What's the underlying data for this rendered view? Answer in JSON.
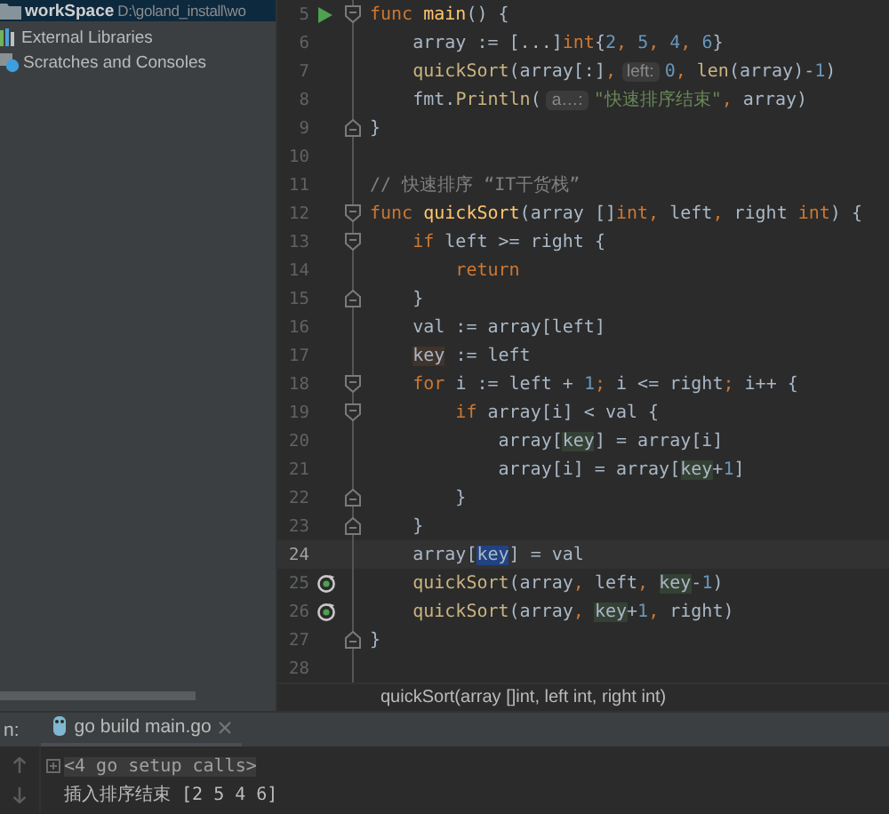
{
  "project_tree": {
    "items": [
      {
        "kind": "folder",
        "label": "workSpace",
        "path": "D:\\goland_install\\wo",
        "selected": true
      },
      {
        "kind": "library",
        "label": "External Libraries",
        "selected": false
      },
      {
        "kind": "scratches",
        "label": "Scratches and Consoles",
        "selected": false
      }
    ]
  },
  "editor": {
    "lines": [
      {
        "number": "5",
        "gutter": [
          {
            "kind": "run"
          },
          {
            "kind": "fold-start"
          }
        ],
        "current": false,
        "tokens": [
          {
            "kind": "keyword",
            "text": "func "
          },
          {
            "kind": "decl",
            "text": "main"
          },
          {
            "kind": "text",
            "text": "() {"
          }
        ]
      },
      {
        "number": "6",
        "current": false,
        "tokens": [
          {
            "kind": "text",
            "text": "    array := [...]"
          },
          {
            "kind": "keyword",
            "text": "int"
          },
          {
            "kind": "text",
            "text": "{"
          },
          {
            "kind": "number",
            "text": "2"
          },
          {
            "kind": "punct",
            "text": ", "
          },
          {
            "kind": "number",
            "text": "5"
          },
          {
            "kind": "punct",
            "text": ", "
          },
          {
            "kind": "number",
            "text": "4"
          },
          {
            "kind": "punct",
            "text": ", "
          },
          {
            "kind": "number",
            "text": "6"
          },
          {
            "kind": "text",
            "text": "}"
          }
        ]
      },
      {
        "number": "7",
        "current": false,
        "tokens": [
          {
            "kind": "call",
            "text": "    quickSort"
          },
          {
            "kind": "text",
            "text": "(array[:]"
          },
          {
            "kind": "punct",
            "text": ","
          },
          {
            "kind": "hint",
            "text": "left:"
          },
          {
            "kind": "number",
            "text": "0"
          },
          {
            "kind": "punct",
            "text": ", "
          },
          {
            "kind": "call",
            "text": "len"
          },
          {
            "kind": "text",
            "text": "(array)-"
          },
          {
            "kind": "number",
            "text": "1"
          },
          {
            "kind": "text",
            "text": ")"
          }
        ]
      },
      {
        "number": "8",
        "current": false,
        "tokens": [
          {
            "kind": "text",
            "text": "    fmt."
          },
          {
            "kind": "call",
            "text": "Println"
          },
          {
            "kind": "text",
            "text": "("
          },
          {
            "kind": "hint",
            "text": "a…:"
          },
          {
            "kind": "string",
            "text": "\"快速排序结束\""
          },
          {
            "kind": "punct",
            "text": ", "
          },
          {
            "kind": "text",
            "text": "array)"
          }
        ]
      },
      {
        "number": "9",
        "gutter": [
          {
            "kind": "fold-end"
          }
        ],
        "current": false,
        "tokens": [
          {
            "kind": "text",
            "text": "}"
          }
        ]
      },
      {
        "number": "10",
        "current": false
      },
      {
        "number": "11",
        "current": false,
        "tokens": [
          {
            "kind": "comment",
            "text": "// 快速排序 “IT干货栈”"
          }
        ]
      },
      {
        "number": "12",
        "gutter": [
          {
            "kind": "fold-start"
          }
        ],
        "current": false,
        "tokens": [
          {
            "kind": "keyword",
            "text": "func "
          },
          {
            "kind": "decl",
            "text": "quickSort"
          },
          {
            "kind": "text",
            "text": "(array []"
          },
          {
            "kind": "keyword",
            "text": "int"
          },
          {
            "kind": "punct",
            "text": ", "
          },
          {
            "kind": "text",
            "text": "left"
          },
          {
            "kind": "punct",
            "text": ", "
          },
          {
            "kind": "text",
            "text": "right "
          },
          {
            "kind": "keyword",
            "text": "int"
          },
          {
            "kind": "text",
            "text": ") {"
          }
        ]
      },
      {
        "number": "13",
        "gutter": [
          {
            "kind": "fold-start"
          }
        ],
        "current": false,
        "tokens": [
          {
            "kind": "keyword",
            "text": "    if "
          },
          {
            "kind": "text",
            "text": "left >= right {"
          }
        ]
      },
      {
        "number": "14",
        "current": false,
        "tokens": [
          {
            "kind": "keyword",
            "text": "        return"
          }
        ]
      },
      {
        "number": "15",
        "gutter": [
          {
            "kind": "fold-end"
          }
        ],
        "current": false,
        "tokens": [
          {
            "kind": "text",
            "text": "    }"
          }
        ]
      },
      {
        "number": "16",
        "current": false,
        "tokens": [
          {
            "kind": "text",
            "text": "    val := array[left]"
          }
        ]
      },
      {
        "number": "17",
        "current": false,
        "tokens": [
          {
            "kind": "write",
            "text": "    key"
          },
          {
            "kind": "text",
            "text": " := left"
          }
        ]
      },
      {
        "number": "18",
        "gutter": [
          {
            "kind": "fold-start"
          }
        ],
        "current": false,
        "tokens": [
          {
            "kind": "keyword",
            "text": "    for "
          },
          {
            "kind": "text",
            "text": "i := left + "
          },
          {
            "kind": "number",
            "text": "1"
          },
          {
            "kind": "punct",
            "text": "; "
          },
          {
            "kind": "text",
            "text": "i <= right"
          },
          {
            "kind": "punct",
            "text": "; "
          },
          {
            "kind": "text",
            "text": "i++ {"
          }
        ]
      },
      {
        "number": "19",
        "gutter": [
          {
            "kind": "fold-start"
          }
        ],
        "current": false,
        "tokens": [
          {
            "kind": "keyword",
            "text": "        if "
          },
          {
            "kind": "text",
            "text": "array[i] < val {"
          }
        ]
      },
      {
        "number": "20",
        "current": false,
        "tokens": [
          {
            "kind": "text",
            "text": "            array["
          },
          {
            "kind": "read",
            "text": "key"
          },
          {
            "kind": "text",
            "text": "] = array[i]"
          }
        ]
      },
      {
        "number": "21",
        "current": false,
        "tokens": [
          {
            "kind": "text",
            "text": "            array[i] = array["
          },
          {
            "kind": "read",
            "text": "key"
          },
          {
            "kind": "text",
            "text": "+"
          },
          {
            "kind": "number",
            "text": "1"
          },
          {
            "kind": "text",
            "text": "]"
          }
        ]
      },
      {
        "number": "22",
        "gutter": [
          {
            "kind": "fold-end"
          }
        ],
        "current": false,
        "tokens": [
          {
            "kind": "text",
            "text": "        }"
          }
        ]
      },
      {
        "number": "23",
        "gutter": [
          {
            "kind": "fold-end"
          }
        ],
        "current": false,
        "tokens": [
          {
            "kind": "text",
            "text": "    }"
          }
        ]
      },
      {
        "number": "24",
        "current": true,
        "tokens": [
          {
            "kind": "text",
            "text": "    array["
          },
          {
            "kind": "selected",
            "text": "key"
          },
          {
            "kind": "text",
            "text": "] = val"
          }
        ]
      },
      {
        "number": "25",
        "gutter": [
          {
            "kind": "recursion"
          }
        ],
        "current": false,
        "tokens": [
          {
            "kind": "call",
            "text": "    quickSort"
          },
          {
            "kind": "text",
            "text": "(array"
          },
          {
            "kind": "punct",
            "text": ", "
          },
          {
            "kind": "text",
            "text": "left"
          },
          {
            "kind": "punct",
            "text": ", "
          },
          {
            "kind": "read",
            "text": "key"
          },
          {
            "kind": "text",
            "text": "-"
          },
          {
            "kind": "number",
            "text": "1"
          },
          {
            "kind": "text",
            "text": ")"
          }
        ]
      },
      {
        "number": "26",
        "gutter": [
          {
            "kind": "recursion"
          }
        ],
        "current": false,
        "tokens": [
          {
            "kind": "call",
            "text": "    quickSort"
          },
          {
            "kind": "text",
            "text": "(array"
          },
          {
            "kind": "punct",
            "text": ", "
          },
          {
            "kind": "read",
            "text": "key"
          },
          {
            "kind": "text",
            "text": "+"
          },
          {
            "kind": "number",
            "text": "1"
          },
          {
            "kind": "punct",
            "text": ", "
          },
          {
            "kind": "text",
            "text": "right)"
          }
        ]
      },
      {
        "number": "27",
        "gutter": [
          {
            "kind": "fold-end"
          }
        ],
        "current": false,
        "tokens": [
          {
            "kind": "text",
            "text": "}"
          }
        ]
      },
      {
        "number": "28",
        "current": false
      }
    ],
    "breadcrumb": "quickSort(array []int, left int, right int)"
  },
  "run_panel": {
    "label": "n:",
    "tabs": [
      {
        "label": "go build main.go",
        "selected": true,
        "closable": true
      }
    ],
    "console": [
      {
        "kind": "collapsed",
        "text": "<4 go setup calls>"
      },
      {
        "kind": "output",
        "text": "插入排序结束 [2 5 4 6]"
      }
    ]
  }
}
